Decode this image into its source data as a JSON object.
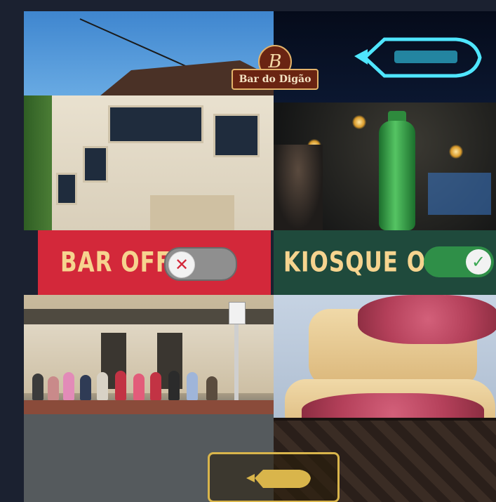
{
  "logo": {
    "initial": "B",
    "name": "Bar do Digão"
  },
  "panels": {
    "left": {
      "label": "BAR OFF",
      "toggle_state": "off",
      "knob_icon": "✕"
    },
    "right": {
      "label": "KIOSQUE ON",
      "toggle_state": "on",
      "knob_icon": "✓"
    }
  },
  "neon_sign": {
    "text": ""
  },
  "bottom_sign": {
    "text": ""
  },
  "colors": {
    "off_banner": "#d3283a",
    "on_banner": "#1f4a3c",
    "banner_text": "#f6d48f",
    "toggle_off": "#8f8f8f",
    "toggle_on": "#2f8f48",
    "sign_gold": "#d9b54b",
    "neon_blue": "#4fe6ff"
  },
  "icons": [
    "x-mark-icon",
    "check-mark-icon",
    "pig-icon",
    "neon-pig-icon"
  ]
}
